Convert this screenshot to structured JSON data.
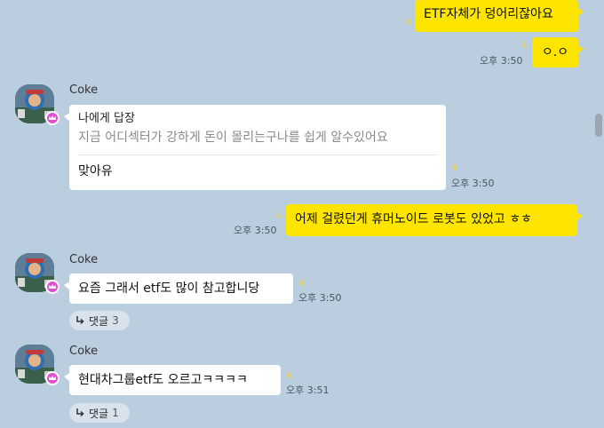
{
  "messages_out": [
    {
      "text": "ETF자체가 덩어리잖아요",
      "unread": "4",
      "time": ""
    },
    {
      "text": "ㅇ.ㅇ",
      "unread": "4",
      "time": "오후 3:50"
    },
    {
      "text": "어제 걸렸던게 휴머노이드 로봇도 있었고 ㅎㅎ",
      "unread": "4",
      "time": "오후 3:50"
    }
  ],
  "sender": {
    "name": "Coke"
  },
  "reply_message": {
    "header": "나에게 답장",
    "quote": "지금 어디섹터가 강하게 돈이 몰리는구나를 쉽게 알수있어요",
    "body": "맞아유",
    "unread": "4",
    "time": "오후 3:50"
  },
  "messages_in": [
    {
      "text": "요즘 그래서 etf도 많이 참고합니당",
      "unread": "4",
      "time": "오후 3:50",
      "comments_label": "댓글",
      "comments_count": "3"
    },
    {
      "text": "현대차그룹etf도 오르고ㅋㅋㅋㅋ",
      "unread": "4",
      "time": "오후 3:51",
      "comments_label": "댓글",
      "comments_count": "1"
    }
  ],
  "icons": {
    "reply_arrow": "reply-arrow-icon",
    "crown_badge": "crown-badge-icon"
  },
  "colors": {
    "background": "#bacee0",
    "my_bubble": "#fee500",
    "other_bubble": "#ffffff",
    "unread": "#f5d33a"
  }
}
